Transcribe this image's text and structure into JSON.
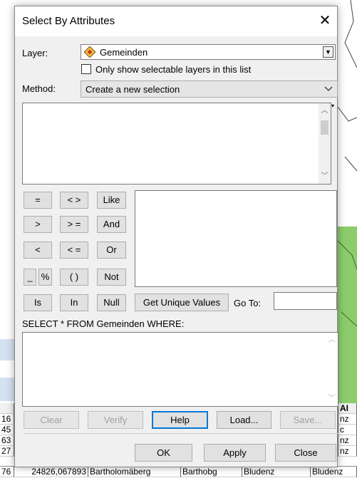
{
  "dialog": {
    "title": "Select By Attributes",
    "close_glyph": "✕"
  },
  "layer": {
    "label": "Layer:",
    "value": "Gemeinden",
    "icon": "layer-diamond-icon",
    "only_selectable_label": "Only show selectable layers in this list",
    "only_selectable_checked": false
  },
  "method": {
    "label": "Method:",
    "value": "Create a new selection"
  },
  "operators": [
    [
      "=",
      "< >",
      "Like"
    ],
    [
      ">",
      "> =",
      "And"
    ],
    [
      "<",
      "< =",
      "Or"
    ],
    [
      "_",
      "%",
      "( )",
      "Not"
    ],
    [
      "Is",
      "In",
      "Null"
    ]
  ],
  "values": {
    "get_unique_label": "Get Unique Values",
    "goto_label": "Go To:",
    "goto_value": ""
  },
  "sql": {
    "prefix": "SELECT * FROM Gemeinden WHERE:",
    "expression": ""
  },
  "actions": {
    "clear": "Clear",
    "verify": "Verify",
    "help": "Help",
    "load": "Load...",
    "save": "Save...",
    "ok": "OK",
    "apply": "Apply",
    "close": "Close"
  },
  "background_table": {
    "left_ids": [
      "16",
      "45",
      "63",
      "27",
      "76"
    ],
    "right_header": "AI",
    "right_vals": [
      "nz",
      "c",
      "nz",
      "nz"
    ],
    "bottom_row": [
      "24826,067893",
      "Bartholomäberg",
      "Barthobg",
      "Bludenz",
      "Bludenz"
    ]
  }
}
